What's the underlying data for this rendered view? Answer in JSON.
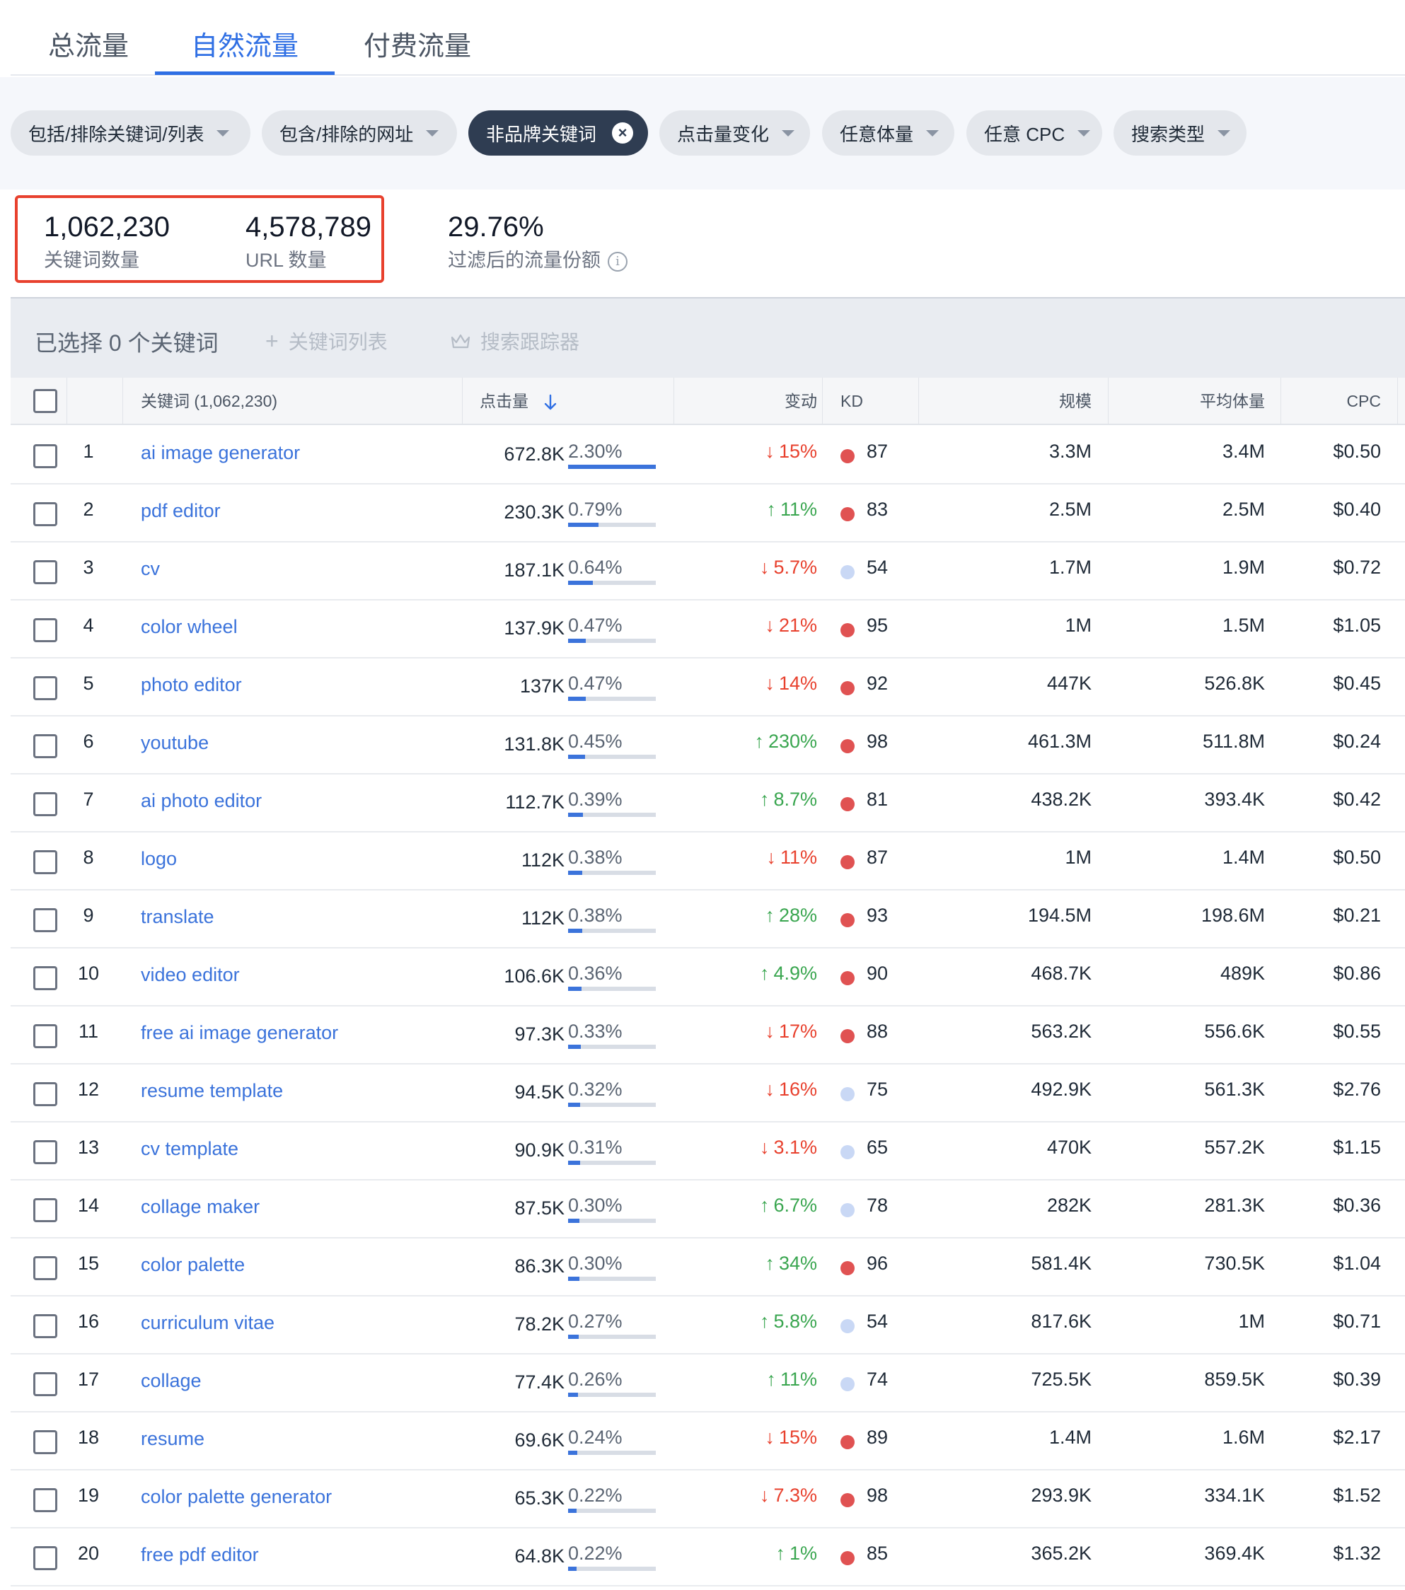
{
  "tabs": [
    "总流量",
    "自然流量",
    "付费流量"
  ],
  "filters": [
    {
      "label": "包括/排除关键词/列表",
      "active": false
    },
    {
      "label": "包含/排除的网址",
      "active": false
    },
    {
      "label": "非品牌关键词",
      "active": true
    },
    {
      "label": "点击量变化",
      "active": false
    },
    {
      "label": "任意体量",
      "active": false
    },
    {
      "label": "任意 CPC",
      "active": false
    },
    {
      "label": "搜索类型",
      "active": false
    }
  ],
  "stats": {
    "keywords_count": "1,062,230",
    "keywords_label": "关键词数量",
    "url_count": "4,578,789",
    "url_label": "URL 数量",
    "share_value": "29.76%",
    "share_label": "过滤后的流量份额"
  },
  "selection": {
    "selected_text": "已选择 0 个关键词",
    "keyword_list_btn": "关键词列表",
    "tracker_btn": "搜索跟踪器"
  },
  "table": {
    "headers": {
      "keyword": "关键词 (1,062,230)",
      "clicks": "点击量",
      "change": "变动",
      "kd": "KD",
      "scale": "规模",
      "avg_volume": "平均体量",
      "cpc": "CPC"
    },
    "rows": [
      {
        "idx": "1",
        "keyword": "ai image generator",
        "clicks": "672.8K",
        "pct": "2.30%",
        "pct_value": 2.3,
        "dir": "down",
        "change": "15%",
        "kd": "87",
        "kd_level": "high",
        "scale": "3.3M",
        "avg": "3.4M",
        "cpc": "$0.50"
      },
      {
        "idx": "2",
        "keyword": "pdf editor",
        "clicks": "230.3K",
        "pct": "0.79%",
        "pct_value": 0.79,
        "dir": "up",
        "change": "11%",
        "kd": "83",
        "kd_level": "high",
        "scale": "2.5M",
        "avg": "2.5M",
        "cpc": "$0.40"
      },
      {
        "idx": "3",
        "keyword": "cv",
        "clicks": "187.1K",
        "pct": "0.64%",
        "pct_value": 0.64,
        "dir": "down",
        "change": "5.7%",
        "kd": "54",
        "kd_level": "low",
        "scale": "1.7M",
        "avg": "1.9M",
        "cpc": "$0.72"
      },
      {
        "idx": "4",
        "keyword": "color wheel",
        "clicks": "137.9K",
        "pct": "0.47%",
        "pct_value": 0.47,
        "dir": "down",
        "change": "21%",
        "kd": "95",
        "kd_level": "high",
        "scale": "1M",
        "avg": "1.5M",
        "cpc": "$1.05"
      },
      {
        "idx": "5",
        "keyword": "photo editor",
        "clicks": "137K",
        "pct": "0.47%",
        "pct_value": 0.47,
        "dir": "down",
        "change": "14%",
        "kd": "92",
        "kd_level": "high",
        "scale": "447K",
        "avg": "526.8K",
        "cpc": "$0.45"
      },
      {
        "idx": "6",
        "keyword": "youtube",
        "clicks": "131.8K",
        "pct": "0.45%",
        "pct_value": 0.45,
        "dir": "up",
        "change": "230%",
        "kd": "98",
        "kd_level": "high",
        "scale": "461.3M",
        "avg": "511.8M",
        "cpc": "$0.24"
      },
      {
        "idx": "7",
        "keyword": "ai photo editor",
        "clicks": "112.7K",
        "pct": "0.39%",
        "pct_value": 0.39,
        "dir": "up",
        "change": "8.7%",
        "kd": "81",
        "kd_level": "high",
        "scale": "438.2K",
        "avg": "393.4K",
        "cpc": "$0.42"
      },
      {
        "idx": "8",
        "keyword": "logo",
        "clicks": "112K",
        "pct": "0.38%",
        "pct_value": 0.38,
        "dir": "down",
        "change": "11%",
        "kd": "87",
        "kd_level": "high",
        "scale": "1M",
        "avg": "1.4M",
        "cpc": "$0.50"
      },
      {
        "idx": "9",
        "keyword": "translate",
        "clicks": "112K",
        "pct": "0.38%",
        "pct_value": 0.38,
        "dir": "up",
        "change": "28%",
        "kd": "93",
        "kd_level": "high",
        "scale": "194.5M",
        "avg": "198.6M",
        "cpc": "$0.21"
      },
      {
        "idx": "10",
        "keyword": "video editor",
        "clicks": "106.6K",
        "pct": "0.36%",
        "pct_value": 0.36,
        "dir": "up",
        "change": "4.9%",
        "kd": "90",
        "kd_level": "high",
        "scale": "468.7K",
        "avg": "489K",
        "cpc": "$0.86"
      },
      {
        "idx": "11",
        "keyword": "free ai image generator",
        "clicks": "97.3K",
        "pct": "0.33%",
        "pct_value": 0.33,
        "dir": "down",
        "change": "17%",
        "kd": "88",
        "kd_level": "high",
        "scale": "563.2K",
        "avg": "556.6K",
        "cpc": "$0.55"
      },
      {
        "idx": "12",
        "keyword": "resume template",
        "clicks": "94.5K",
        "pct": "0.32%",
        "pct_value": 0.32,
        "dir": "down",
        "change": "16%",
        "kd": "75",
        "kd_level": "low",
        "scale": "492.9K",
        "avg": "561.3K",
        "cpc": "$2.76"
      },
      {
        "idx": "13",
        "keyword": "cv template",
        "clicks": "90.9K",
        "pct": "0.31%",
        "pct_value": 0.31,
        "dir": "down",
        "change": "3.1%",
        "kd": "65",
        "kd_level": "low",
        "scale": "470K",
        "avg": "557.2K",
        "cpc": "$1.15"
      },
      {
        "idx": "14",
        "keyword": "collage maker",
        "clicks": "87.5K",
        "pct": "0.30%",
        "pct_value": 0.3,
        "dir": "up",
        "change": "6.7%",
        "kd": "78",
        "kd_level": "low",
        "scale": "282K",
        "avg": "281.3K",
        "cpc": "$0.36"
      },
      {
        "idx": "15",
        "keyword": "color palette",
        "clicks": "86.3K",
        "pct": "0.30%",
        "pct_value": 0.3,
        "dir": "up",
        "change": "34%",
        "kd": "96",
        "kd_level": "high",
        "scale": "581.4K",
        "avg": "730.5K",
        "cpc": "$1.04"
      },
      {
        "idx": "16",
        "keyword": "curriculum vitae",
        "clicks": "78.2K",
        "pct": "0.27%",
        "pct_value": 0.27,
        "dir": "up",
        "change": "5.8%",
        "kd": "54",
        "kd_level": "low",
        "scale": "817.6K",
        "avg": "1M",
        "cpc": "$0.71"
      },
      {
        "idx": "17",
        "keyword": "collage",
        "clicks": "77.4K",
        "pct": "0.26%",
        "pct_value": 0.26,
        "dir": "up",
        "change": "11%",
        "kd": "74",
        "kd_level": "low",
        "scale": "725.5K",
        "avg": "859.5K",
        "cpc": "$0.39"
      },
      {
        "idx": "18",
        "keyword": "resume",
        "clicks": "69.6K",
        "pct": "0.24%",
        "pct_value": 0.24,
        "dir": "down",
        "change": "15%",
        "kd": "89",
        "kd_level": "high",
        "scale": "1.4M",
        "avg": "1.6M",
        "cpc": "$2.17"
      },
      {
        "idx": "19",
        "keyword": "color palette generator",
        "clicks": "65.3K",
        "pct": "0.22%",
        "pct_value": 0.22,
        "dir": "down",
        "change": "7.3%",
        "kd": "98",
        "kd_level": "high",
        "scale": "293.9K",
        "avg": "334.1K",
        "cpc": "$1.52"
      },
      {
        "idx": "20",
        "keyword": "free pdf editor",
        "clicks": "64.8K",
        "pct": "0.22%",
        "pct_value": 0.22,
        "dir": "up",
        "change": "1%",
        "kd": "85",
        "kd_level": "high",
        "scale": "365.2K",
        "avg": "369.4K",
        "cpc": "$1.32"
      }
    ]
  },
  "colors": {
    "accent": "#2f6fe4",
    "link": "#3b73db",
    "up": "#3aa650",
    "down": "#e8412e",
    "kd_high": "#e05252",
    "kd_low": "#c9d8f5",
    "highlight_box": "#e8412e"
  },
  "icons": {
    "close": "close-icon",
    "caret": "chevron-down-icon",
    "info": "info-icon",
    "plus": "plus-icon",
    "crown": "crown-icon",
    "sort": "arrow-down-icon",
    "trend_up": "arrow-up-icon",
    "trend_down": "arrow-down-icon"
  }
}
